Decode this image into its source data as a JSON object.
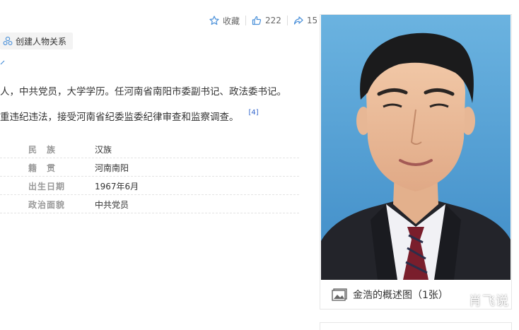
{
  "toolbar": {
    "collect_label": "收藏",
    "like_count": "222",
    "share_count": "15"
  },
  "relation_button": "创建人物关系",
  "paragraphs": {
    "p1": "人，中共党员，大学学历。任河南省南阳市委副书记、政法委书记。",
    "p2": "重违纪违法，接受河南省纪委监委纪律审查和监察调查。",
    "p2_ref": "[4]"
  },
  "info": [
    {
      "key": "民　族",
      "value": "汉族"
    },
    {
      "key": "籍　贯",
      "value": "河南南阳"
    },
    {
      "key": "出生日期",
      "value": "1967年6月"
    },
    {
      "key": "政治面貌",
      "value": "中共党员"
    }
  ],
  "photo": {
    "caption": "金浩的概述图（1张）",
    "watermark": "肖飞说"
  },
  "colors": {
    "photo_bg": "#5aa3d6",
    "link": "#3366cc",
    "icon": "#4a90d9"
  }
}
